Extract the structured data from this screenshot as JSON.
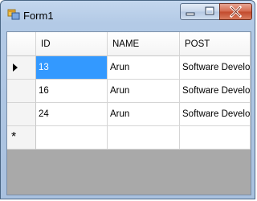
{
  "window": {
    "title": "Form1",
    "icon": "form-app-icon",
    "buttons": {
      "minimize": "minimize-icon",
      "maximize": "maximize-icon",
      "close": "close-icon"
    }
  },
  "grid": {
    "columns": [
      "ID",
      "NAME",
      "POST"
    ],
    "rows": [
      {
        "id": "13",
        "name": "Arun",
        "post": "Software Develo...",
        "current": true
      },
      {
        "id": "16",
        "name": "Arun",
        "post": "Software Develo...",
        "current": false
      },
      {
        "id": "24",
        "name": "Arun",
        "post": "Software Develo...",
        "current": false
      }
    ],
    "new_row_marker": "*",
    "colors": {
      "selection": "#3399ff",
      "empty_area": "#a9a9a9"
    }
  }
}
